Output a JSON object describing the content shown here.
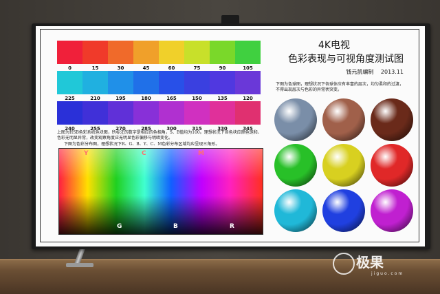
{
  "chart": {
    "row1": {
      "colors": [
        "#f0203a",
        "#f03a2a",
        "#f06a2a",
        "#f0a02a",
        "#f0d02a",
        "#c8e02a",
        "#7ad82a",
        "#40d040"
      ],
      "labels": [
        "0",
        "15",
        "30",
        "45",
        "60",
        "75",
        "90",
        "105"
      ]
    },
    "row2": {
      "colors": [
        "#20c8d8",
        "#20b0e0",
        "#2090e8",
        "#2070e8",
        "#2850e8",
        "#3a40e0",
        "#5038e0",
        "#6a38d8"
      ],
      "labels": [
        "225",
        "210",
        "195",
        "180",
        "165",
        "150",
        "135",
        "120"
      ]
    },
    "row3": {
      "colors": [
        "#2a30d8",
        "#4030d8",
        "#6030d8",
        "#8830d8",
        "#b030d0",
        "#d030c0",
        "#e0309a",
        "#e03070"
      ],
      "labels": [
        "240",
        "255",
        "270",
        "285",
        "300",
        "315",
        "330",
        "345"
      ]
    },
    "title_line1": "4K电视",
    "title_line2": "色彩表现与可视角度测试图",
    "author": "钱元凯编制",
    "date": "2013.11",
    "left_text": "上图为HSB色彩系统色块图，所标注的数字是相应的色相角，S、B值均为100。理想状况下各色块应颜色饱和、色彩无明显异常，改变观察角度应无明显色彩偏移与明暗变化。",
    "left_text2": "下图为色彩分布图，理想状况下R、G、B、Y、C、M色彩分布区域均应呈现三角形。",
    "right_text": "下图为色球图，理想状况下各球体应有丰富的层次，均匀柔和的过渡，不得出现层次与色彩的异常状突变。",
    "grad_top": [
      "Y",
      "C",
      "M"
    ],
    "grad_bottom": [
      "G",
      "B",
      "R"
    ],
    "spheres": [
      "#7a8ea8",
      "#a0604a",
      "#6a2a1a",
      "#28c028",
      "#d8d020",
      "#e02828",
      "#20b8d8",
      "#2040e0",
      "#c020d0"
    ]
  },
  "watermark": {
    "brand": "极果",
    "site": "jiguo.com"
  }
}
